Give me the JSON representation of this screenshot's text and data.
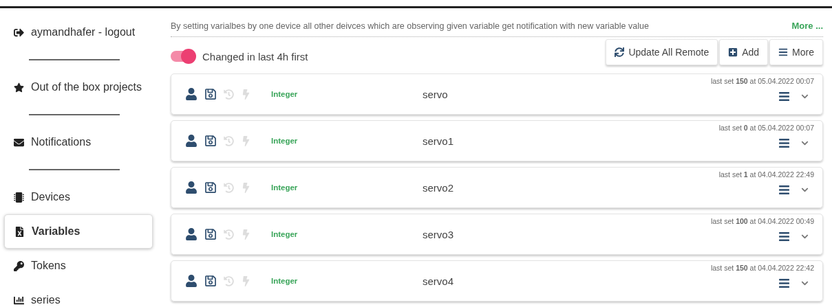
{
  "sidebar": {
    "items": [
      {
        "kind": "logout",
        "label": "aymandhafer - logout",
        "selected": false,
        "divider_after": true
      },
      {
        "kind": "star",
        "label": "Out of the box projects",
        "selected": false,
        "divider_after": true
      },
      {
        "kind": "envelope",
        "label": "Notifications",
        "selected": false,
        "divider_after": true
      },
      {
        "kind": "chip",
        "label": "Devices",
        "selected": false,
        "divider_after": false
      },
      {
        "kind": "file",
        "label": "Variables",
        "selected": true,
        "divider_after": false
      },
      {
        "kind": "key",
        "label": "Tokens",
        "selected": false,
        "divider_after": false
      },
      {
        "kind": "chart",
        "label": "series",
        "selected": false,
        "divider_after": false
      }
    ]
  },
  "info": {
    "text": "By setting varialbes by one device all other deivces which are observing given variable get notification with new variable value",
    "link": "More ..."
  },
  "toggle": {
    "label": "Changed in last 4h first",
    "on": true
  },
  "buttons": [
    {
      "kind": "sync",
      "label": "Update All Remote"
    },
    {
      "kind": "add",
      "label": "Add"
    },
    {
      "kind": "menu",
      "label": "More"
    }
  ],
  "variables": [
    {
      "type": "Integer",
      "name": "servo",
      "last_set": "last set **150** at 05.04.2022 00:07"
    },
    {
      "type": "Integer",
      "name": "servo1",
      "last_set": "last set **0** at 05.04.2022 00:07"
    },
    {
      "type": "Integer",
      "name": "servo2",
      "last_set": "last set **1** at 04.04.2022 22:49"
    },
    {
      "type": "Integer",
      "name": "servo3",
      "last_set": "last set **100** at 04.04.2022 00:49"
    },
    {
      "type": "Integer",
      "name": "servo4",
      "last_set": "last set **150** at 04.04.2022 22:42"
    }
  ]
}
